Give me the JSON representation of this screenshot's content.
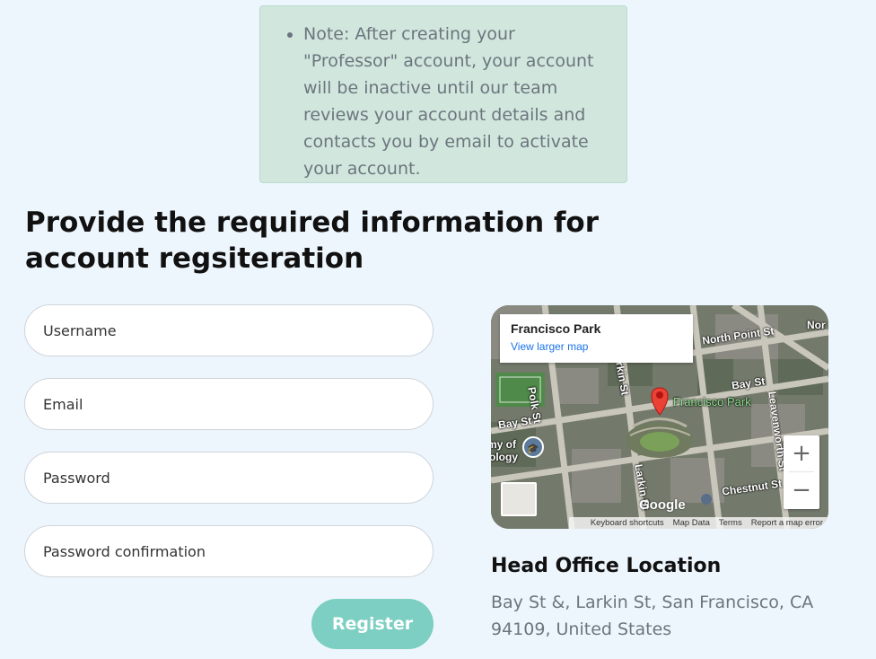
{
  "note": {
    "text": "Note: After creating your \"Professor\" account, your account will be inactive until our team reviews your account details and contacts you by email to activate your account."
  },
  "heading": "Provide the required information for account regsiteration",
  "form": {
    "username_placeholder": "Username",
    "email_placeholder": "Email",
    "password_placeholder": "Password",
    "password_confirmation_placeholder": "Password confirmation",
    "register_label": "Register"
  },
  "map": {
    "place_name": "Francisco Park",
    "view_larger": "View larger map",
    "zoom_in": "+",
    "zoom_out": "−",
    "google": "Google",
    "footer": {
      "shortcuts": "Keyboard shortcuts",
      "map_data": "Map Data",
      "terms": "Terms",
      "report": "Report a map error"
    },
    "labels": {
      "north_point": "North Point St",
      "bay_st_1": "Bay St",
      "bay_st_2": "Bay St",
      "park": "Francisco Park",
      "leavenworth": "Leavenworth St",
      "larkin_1": "rkin St",
      "larkin_2": "Larkin St",
      "polk": "Polk St",
      "chestnut": "Chestnut St",
      "academy": "my of",
      "ology": "ology",
      "nor": "Nor"
    }
  },
  "location": {
    "title": "Head Office Location",
    "address": "Bay St &, Larkin St, San Francisco, CA 94109, United States"
  },
  "colors": {
    "background": "#eef6fd",
    "note_bg": "#d1e7dd",
    "register_bg": "#7ccfc2",
    "pin": "#ea4335"
  }
}
